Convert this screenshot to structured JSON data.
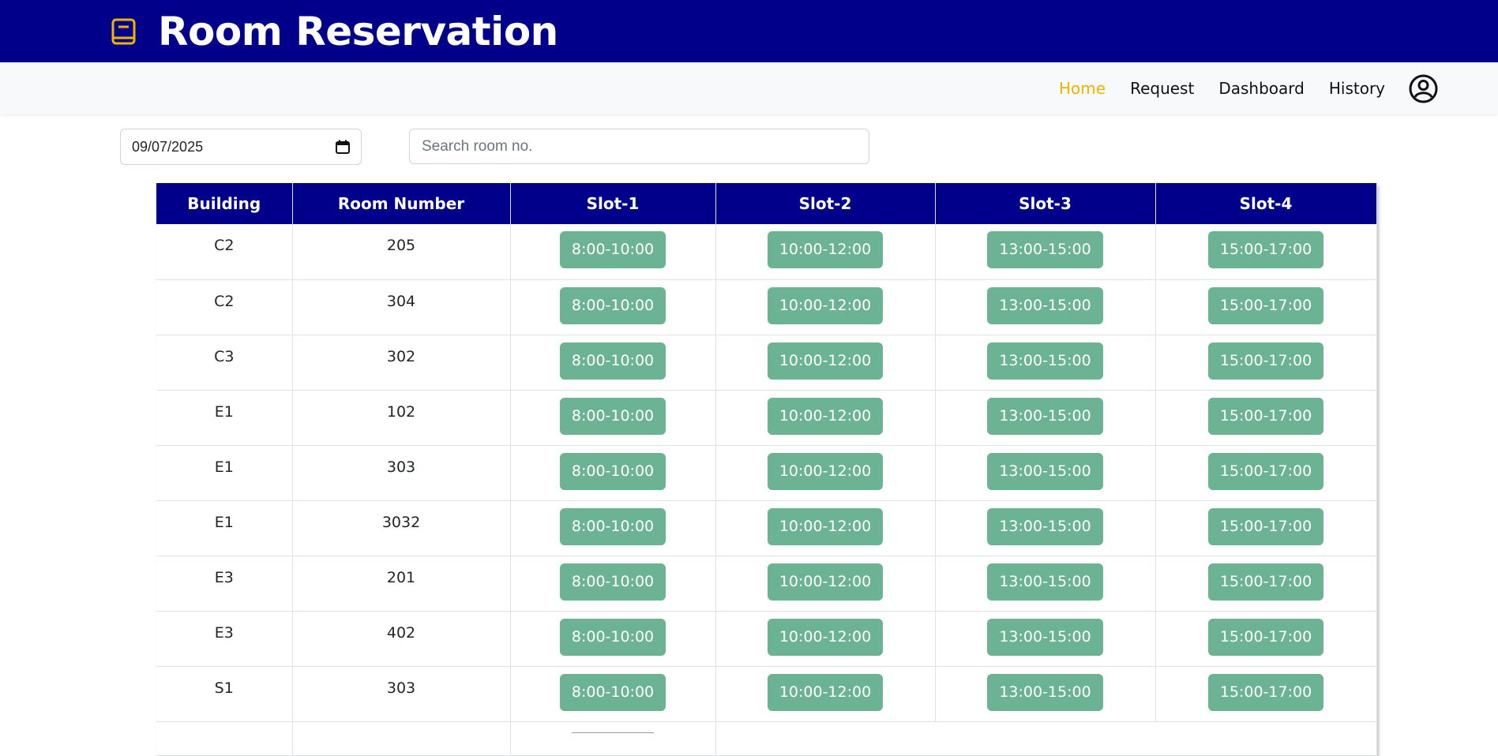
{
  "header": {
    "title": "Room Reservation",
    "logo_icon": "book-icon"
  },
  "nav": {
    "links": [
      {
        "label": "Home",
        "active": true
      },
      {
        "label": "Request",
        "active": false
      },
      {
        "label": "Dashboard",
        "active": false
      },
      {
        "label": "History",
        "active": false
      }
    ],
    "user_icon": "user-circle-icon"
  },
  "filters": {
    "date_value": "09/07/2025",
    "search_placeholder": "Search room no."
  },
  "table": {
    "columns": [
      "Building",
      "Room Number",
      "Slot-1",
      "Slot-2",
      "Slot-3",
      "Slot-4"
    ],
    "rows": [
      {
        "building": "C2",
        "room": "205",
        "slots": [
          "8:00-10:00",
          "10:00-12:00",
          "13:00-15:00",
          "15:00-17:00"
        ]
      },
      {
        "building": "C2",
        "room": "304",
        "slots": [
          "8:00-10:00",
          "10:00-12:00",
          "13:00-15:00",
          "15:00-17:00"
        ]
      },
      {
        "building": "C3",
        "room": "302",
        "slots": [
          "8:00-10:00",
          "10:00-12:00",
          "13:00-15:00",
          "15:00-17:00"
        ]
      },
      {
        "building": "E1",
        "room": "102",
        "slots": [
          "8:00-10:00",
          "10:00-12:00",
          "13:00-15:00",
          "15:00-17:00"
        ]
      },
      {
        "building": "E1",
        "room": "303",
        "slots": [
          "8:00-10:00",
          "10:00-12:00",
          "13:00-15:00",
          "15:00-17:00"
        ]
      },
      {
        "building": "E1",
        "room": "3032",
        "slots": [
          "8:00-10:00",
          "10:00-12:00",
          "13:00-15:00",
          "15:00-17:00"
        ]
      },
      {
        "building": "E3",
        "room": "201",
        "slots": [
          "8:00-10:00",
          "10:00-12:00",
          "13:00-15:00",
          "15:00-17:00"
        ]
      },
      {
        "building": "E3",
        "room": "402",
        "slots": [
          "8:00-10:00",
          "10:00-12:00",
          "13:00-15:00",
          "15:00-17:00"
        ]
      },
      {
        "building": "S1",
        "room": "303",
        "slots": [
          "8:00-10:00",
          "10:00-12:00",
          "13:00-15:00",
          "15:00-17:00"
        ]
      }
    ]
  },
  "colors": {
    "header_bg": "#00008b",
    "nav_active": "#f0b400",
    "slot_available": "#6bb393"
  }
}
